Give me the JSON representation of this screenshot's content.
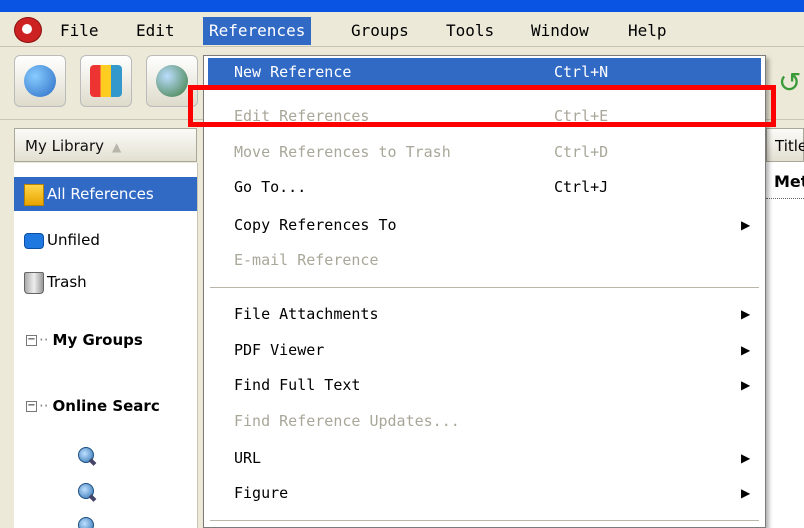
{
  "menubar": {
    "items": [
      {
        "label": "File"
      },
      {
        "label": "Edit"
      },
      {
        "label": "References"
      },
      {
        "label": "Groups"
      },
      {
        "label": "Tools"
      },
      {
        "label": "Window"
      },
      {
        "label": "Help"
      }
    ]
  },
  "library": {
    "header": "My Library",
    "collections": [
      {
        "label": "All References",
        "icon": "folder-star-icon",
        "selected": true
      },
      {
        "label": "Unfiled",
        "icon": "folder-icon"
      },
      {
        "label": "Trash",
        "icon": "trash-icon"
      }
    ],
    "groups_heading": "My Groups",
    "online_heading": "Online Searc"
  },
  "reference_list": {
    "column_header": "Title",
    "first_cell": "Meth"
  },
  "references_menu": {
    "items": [
      {
        "label": "New Reference",
        "shortcut": "Ctrl+N",
        "state": "highlighted"
      },
      {
        "label": "Edit References",
        "shortcut": "Ctrl+E",
        "state": "disabled"
      },
      {
        "label": "Move References to Trash",
        "shortcut": "Ctrl+D",
        "state": "disabled"
      },
      {
        "label": "Go To...",
        "shortcut": "Ctrl+J",
        "state": "enabled"
      },
      {
        "label": "Copy References To",
        "submenu": true,
        "state": "enabled"
      },
      {
        "label": "E-mail Reference",
        "state": "disabled"
      },
      {
        "label": "File Attachments",
        "submenu": true,
        "state": "enabled"
      },
      {
        "label": "PDF Viewer",
        "submenu": true,
        "state": "enabled"
      },
      {
        "label": "Find Full Text",
        "submenu": true,
        "state": "enabled"
      },
      {
        "label": "Find Reference Updates...",
        "state": "disabled"
      },
      {
        "label": "URL",
        "submenu": true,
        "state": "enabled"
      },
      {
        "label": "Figure",
        "submenu": true,
        "state": "enabled"
      }
    ]
  },
  "colors": {
    "highlight": "#316ac5",
    "annotation": "#ff0000",
    "disabled_text": "#a9a799"
  }
}
